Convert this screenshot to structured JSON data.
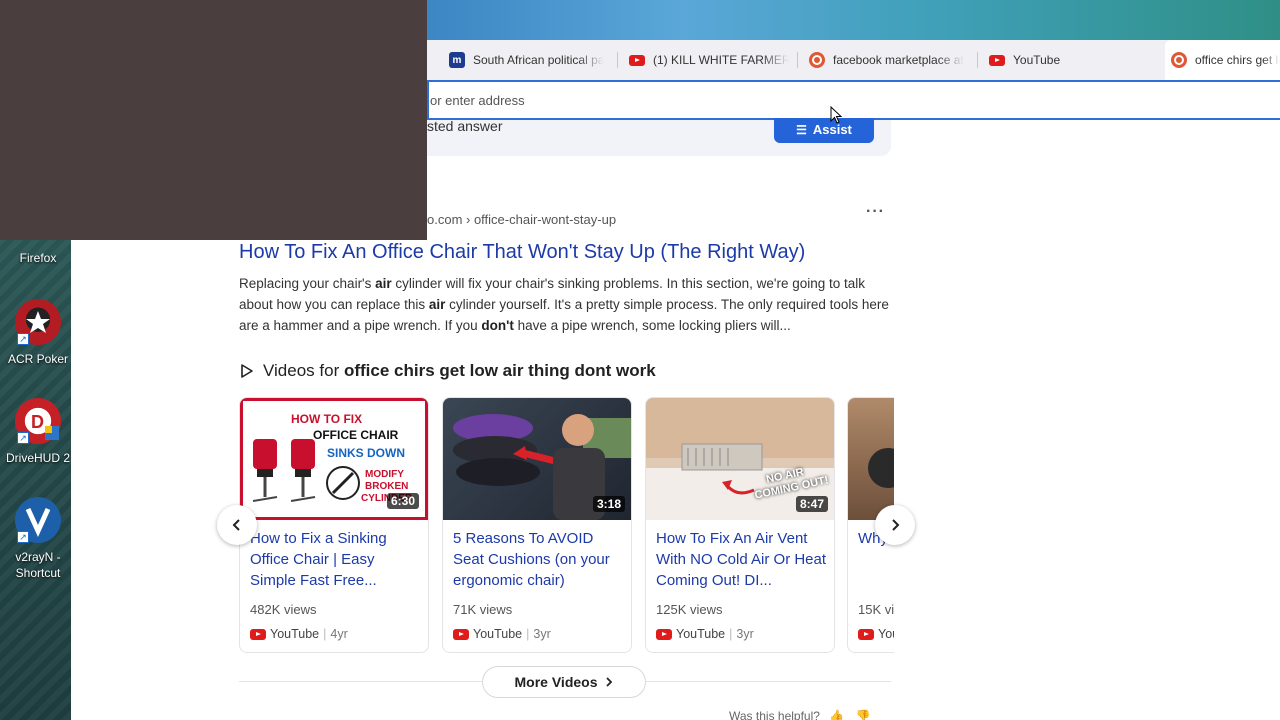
{
  "desktop": {
    "icons": [
      {
        "label": "Firefox",
        "icon": "firefox-icon"
      },
      {
        "label": "ACR Poker",
        "icon": "acr-poker-icon"
      },
      {
        "label": "DriveHUD 2",
        "icon": "drivehud-icon"
      },
      {
        "label_line1": "v2rayN -",
        "label_line2": "Shortcut",
        "icon": "v2rayn-icon"
      }
    ]
  },
  "browser": {
    "tabs": [
      {
        "title": "South African political pa",
        "icon": "news-site-icon"
      },
      {
        "title": "(1) KILL WHITE FARMER V",
        "icon": "youtube-icon"
      },
      {
        "title": "facebook marketplace at",
        "icon": "duckduckgo-icon"
      },
      {
        "title": "YouTube",
        "icon": "youtube-icon"
      },
      {
        "title": "office chirs get lo",
        "icon": "duckduckgo-icon",
        "active": true
      }
    ],
    "address_placeholder": "or enter address"
  },
  "results": {
    "answer_partial": "sted answer",
    "assist_label": "Assist",
    "breadcrumb": "o.com › office-chair-wont-stay-up",
    "more_label": "···",
    "title": "How To Fix An Office Chair That Won't Stay Up (The Right Way)",
    "snippet": [
      {
        "t": "Replacing your chair's ",
        "b": false
      },
      {
        "t": "air",
        "b": true
      },
      {
        "t": " cylinder will fix your chair's sinking problems. In this section, we're going to talk about how you can replace this ",
        "b": false
      },
      {
        "t": "air",
        "b": true
      },
      {
        "t": " cylinder yourself. It's a pretty simple process. The only required tools here are a hammer and a pipe wrench. If you ",
        "b": false
      },
      {
        "t": "don't",
        "b": true
      },
      {
        "t": " have a pipe wrench, some locking pliers will...",
        "b": false
      }
    ]
  },
  "videos": {
    "heading_prefix": "Videos for ",
    "heading_query": "office chirs get low air thing dont work",
    "items": [
      {
        "title": "How to Fix a Sinking Office Chair | Easy Simple Fast Free...",
        "views": "482K views",
        "source": "YouTube",
        "age": "4yr",
        "duration": "6:30",
        "thumb_text": [
          "HOW TO FIX",
          "OFFICE CHAIR",
          "SINKS DOWN",
          "MODIFY",
          "BROKEN",
          "CYLINDER"
        ]
      },
      {
        "title": "5 Reasons To AVOID Seat Cushions (on your ergonomic chair)",
        "views": "71K views",
        "source": "YouTube",
        "age": "3yr",
        "duration": "3:18"
      },
      {
        "title": "How To Fix An Air Vent With NO Cold Air Or Heat Coming Out! DI...",
        "views": "125K views",
        "source": "YouTube",
        "age": "3yr",
        "duration": "8:47",
        "thumb_text": [
          "NO AIR",
          "COMING OUT!"
        ]
      },
      {
        "title": "Why Blowi Troub",
        "views": "15K vi",
        "source": "You",
        "age": "",
        "duration": ""
      }
    ],
    "more_label": "More Videos"
  },
  "feedback": {
    "label": "Was this helpful?"
  },
  "colors": {
    "link": "#1c3aa9",
    "assist": "#2463d8",
    "youtube": "#e01b1b",
    "focus": "#2d6fd6"
  }
}
